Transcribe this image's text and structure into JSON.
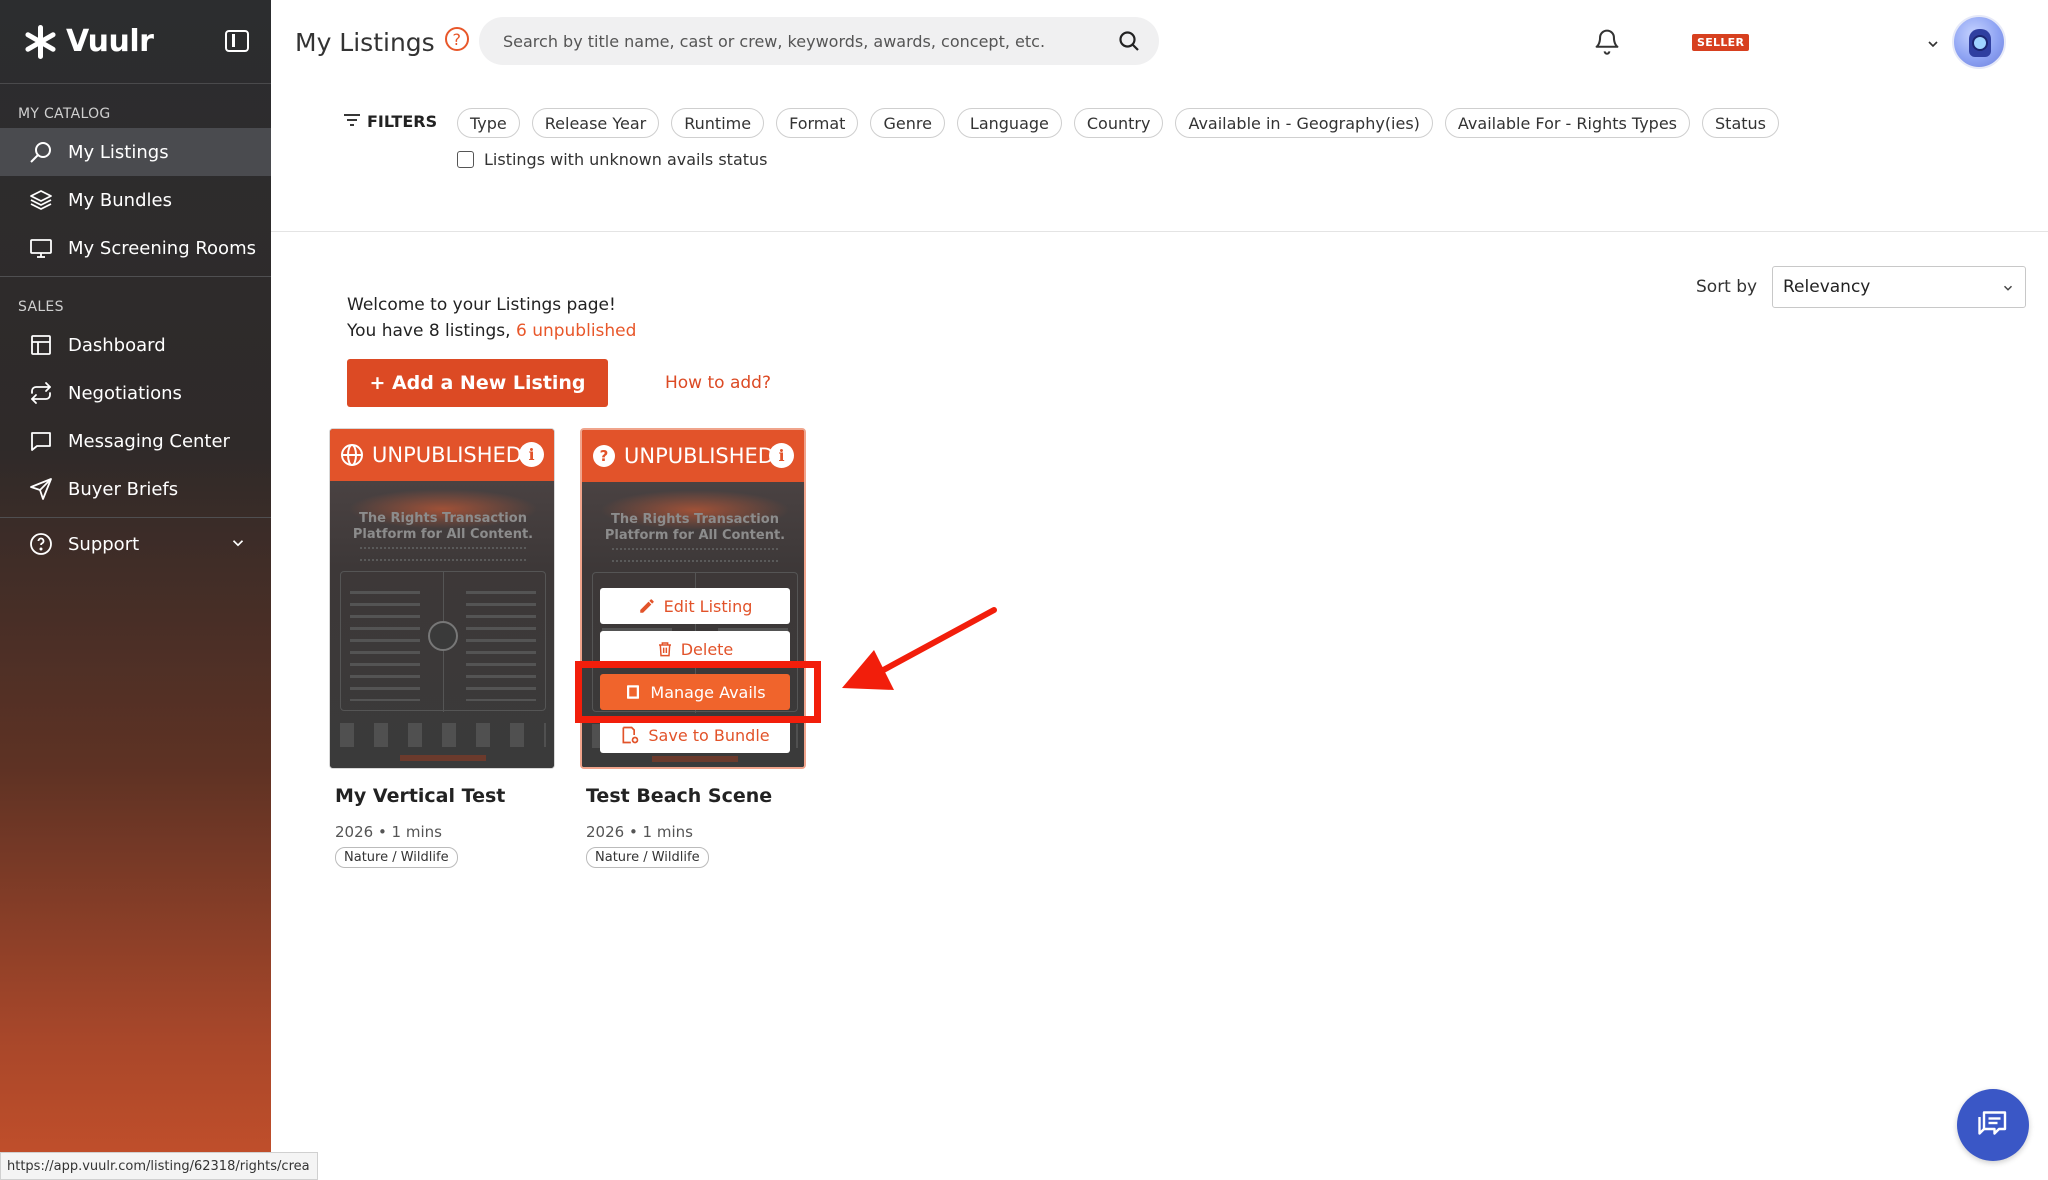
{
  "brand": {
    "name": "Vuulr"
  },
  "sidebar": {
    "sections": [
      {
        "label": "MY CATALOG"
      },
      {
        "label": "SALES"
      }
    ],
    "catalog_items": [
      {
        "label": "My Listings",
        "icon": "search-icon"
      },
      {
        "label": "My Bundles",
        "icon": "layers-icon"
      },
      {
        "label": "My Screening Rooms",
        "icon": "monitor-icon"
      }
    ],
    "sales_items": [
      {
        "label": "Dashboard",
        "icon": "dashboard-icon"
      },
      {
        "label": "Negotiations",
        "icon": "repeat-icon"
      },
      {
        "label": "Messaging Center",
        "icon": "message-icon"
      },
      {
        "label": "Buyer Briefs",
        "icon": "send-icon"
      }
    ],
    "support": {
      "label": "Support",
      "icon": "help-circle-icon"
    }
  },
  "header": {
    "title": "My Listings",
    "help_glyph": "?",
    "search_placeholder": "Search by title name, cast or crew, keywords, awards, concept, etc.",
    "seller_badge": "SELLER"
  },
  "filters": {
    "label": "FILTERS",
    "chips": [
      "Type",
      "Release Year",
      "Runtime",
      "Format",
      "Genre",
      "Language",
      "Country",
      "Available in - Geography(ies)",
      "Available For - Rights Types",
      "Status"
    ],
    "unknown_avails_label": "Listings with unknown avails status"
  },
  "sort": {
    "label": "Sort by",
    "value": "Relevancy"
  },
  "welcome": {
    "line1": "Welcome to your Listings page!",
    "line2_prefix": "You have 8 listings, ",
    "line2_accent": "6 unpublished",
    "add_button": "+ Add a New Listing",
    "how_to": "How to add?"
  },
  "listings": [
    {
      "status": "UNPUBLISHED",
      "title": "My Vertical Test",
      "meta": "2026 • 1 mins",
      "tag": "Nature / Wildlife",
      "poster_title": "The Rights Transaction Platform for All Content."
    },
    {
      "status": "UNPUBLISHED",
      "title": "Test Beach Scene",
      "meta": "2026 • 1 mins",
      "tag": "Nature / Wildlife",
      "poster_title": "The Rights Transaction Platform for All Content.",
      "actions": {
        "edit": "Edit Listing",
        "delete": "Delete",
        "manage": "Manage Avails",
        "bundle": "Save to Bundle"
      }
    }
  ],
  "status_url": "https://app.vuulr.com/listing/62318/rights/crea",
  "colors": {
    "accent": "#dc4a24",
    "highlight": "#f21e0b",
    "chat": "#3a57c6"
  }
}
